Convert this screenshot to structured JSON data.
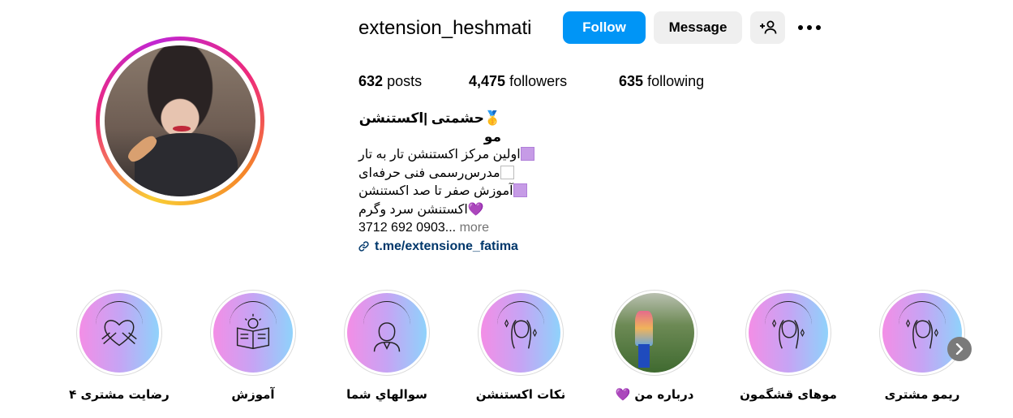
{
  "profile": {
    "username": "extension_heshmati",
    "follow_label": "Follow",
    "message_label": "Message",
    "suggest_icon": "person-plus-icon",
    "more_icon": "more-horizontal-icon"
  },
  "stats": {
    "posts_count": "632",
    "posts_label": "posts",
    "followers_count": "4,475",
    "followers_label": "followers",
    "following_count": "635",
    "following_label": "following"
  },
  "bio": {
    "name": "حشمتی |اکستنشن مو",
    "name_emoji": "🥇",
    "line1": "اولین مرکز اکستنشن تار به تار",
    "line2": "مدرس‌رسمی فنی حرفه‌ای",
    "line3": "آموزش صفر تا صد اکستنشن",
    "line4": "اکستنشن سرد وگرم",
    "line4_emoji": "💜",
    "phone": "3712 692 0903...",
    "more_label": "more",
    "link": "t.me/extensione_fatima",
    "link_icon": "link-icon"
  },
  "highlights": [
    {
      "label": "رضایت مشتری ۴",
      "icon": "heart-hands-icon"
    },
    {
      "label": "آموزش",
      "icon": "book-bulb-icon"
    },
    {
      "label": "سوالهاي شما",
      "icon": "woman-portrait-icon"
    },
    {
      "label": "نکات اکستنشن",
      "icon": "hair-sparkle-icon"
    },
    {
      "label": "درباره من 💜",
      "icon": "photo-thumbnail"
    },
    {
      "label": "موهای قشگمون",
      "icon": "hair-sparkle-icon"
    },
    {
      "label": "ریمو مشتری",
      "icon": "hair-sparkle-icon"
    }
  ],
  "colors": {
    "follow_blue": "#0095f6",
    "secondary_button": "#efefef",
    "link_color": "#00376b",
    "muted_text": "#737373"
  }
}
